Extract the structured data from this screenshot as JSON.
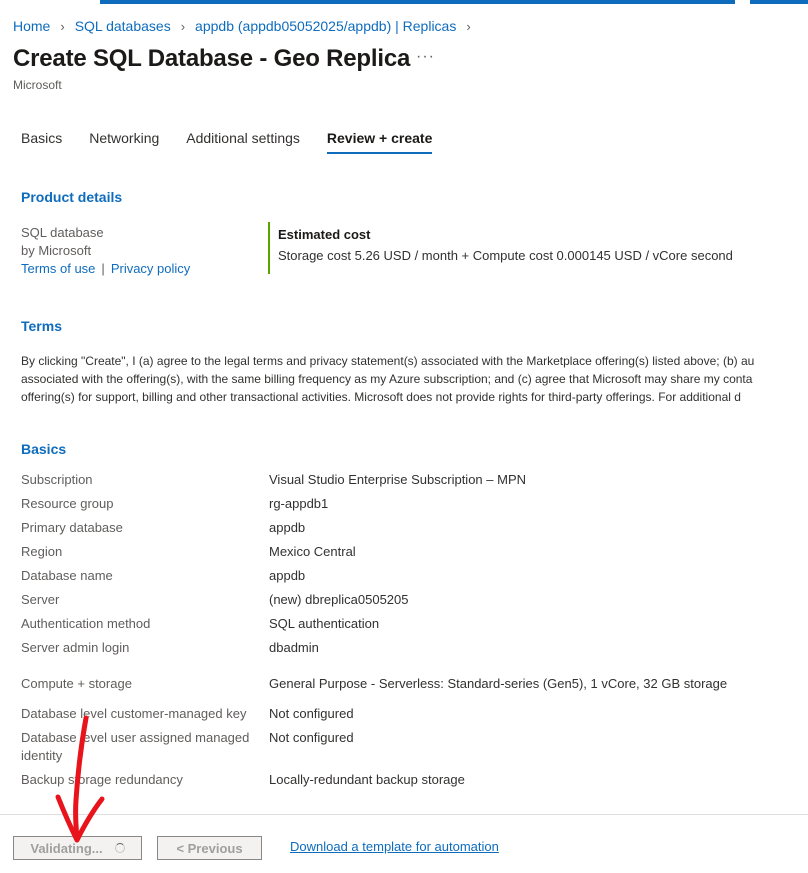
{
  "breadcrumb": [
    "Home",
    "SQL databases",
    "appdb (appdb05052025/appdb) | Replicas"
  ],
  "title": "Create SQL Database - Geo Replica",
  "publisher": "Microsoft",
  "tabs": [
    "Basics",
    "Networking",
    "Additional settings",
    "Review + create"
  ],
  "active_tab": "Review + create",
  "product_details": {
    "heading": "Product details",
    "name": "SQL database",
    "by": "by Microsoft",
    "terms_link": "Terms of use",
    "separator": "|",
    "privacy_link": "Privacy policy",
    "cost_title": "Estimated cost",
    "cost_text": "Storage cost 5.26 USD / month + Compute cost 0.000145 USD / vCore second"
  },
  "terms": {
    "heading": "Terms",
    "lines": [
      "By clicking \"Create\", I (a) agree to the legal terms and privacy statement(s) associated with the Marketplace offering(s) listed above; (b) au",
      "associated with the offering(s), with the same billing frequency as my Azure subscription; and (c) agree that Microsoft may share my conta",
      "offering(s) for support, billing and other transactional activities. Microsoft does not provide rights for third-party offerings. For additional d"
    ]
  },
  "basics": {
    "heading": "Basics",
    "rows": [
      {
        "key": "Subscription",
        "value": "Visual Studio Enterprise Subscription – MPN"
      },
      {
        "key": "Resource group",
        "value": "rg-appdb1"
      },
      {
        "key": "Primary database",
        "value": "appdb"
      },
      {
        "key": "Region",
        "value": "Mexico Central"
      },
      {
        "key": "Database name",
        "value": "appdb"
      },
      {
        "key": "Server",
        "value": "(new) dbreplica0505205"
      },
      {
        "key": "Authentication method",
        "value": "SQL authentication"
      },
      {
        "key": "Server admin login",
        "value": "dbadmin"
      },
      {
        "key": "Compute + storage",
        "value": "General Purpose - Serverless: Standard-series (Gen5), 1 vCore, 32 GB storage"
      },
      {
        "key": "Database level customer-managed key",
        "value": "Not configured"
      },
      {
        "key": "Database level user assigned managed identity",
        "value": "Not configured"
      },
      {
        "key": "Backup storage redundancy",
        "value": "Locally-redundant backup storage"
      }
    ]
  },
  "footer": {
    "validating_label": "Validating...",
    "previous_label": "< Previous",
    "download_label": "Download a template for automation"
  },
  "colors": {
    "accent": "#0f6cbd",
    "cost_bar": "#57a300",
    "annotation": "#e8131b"
  }
}
